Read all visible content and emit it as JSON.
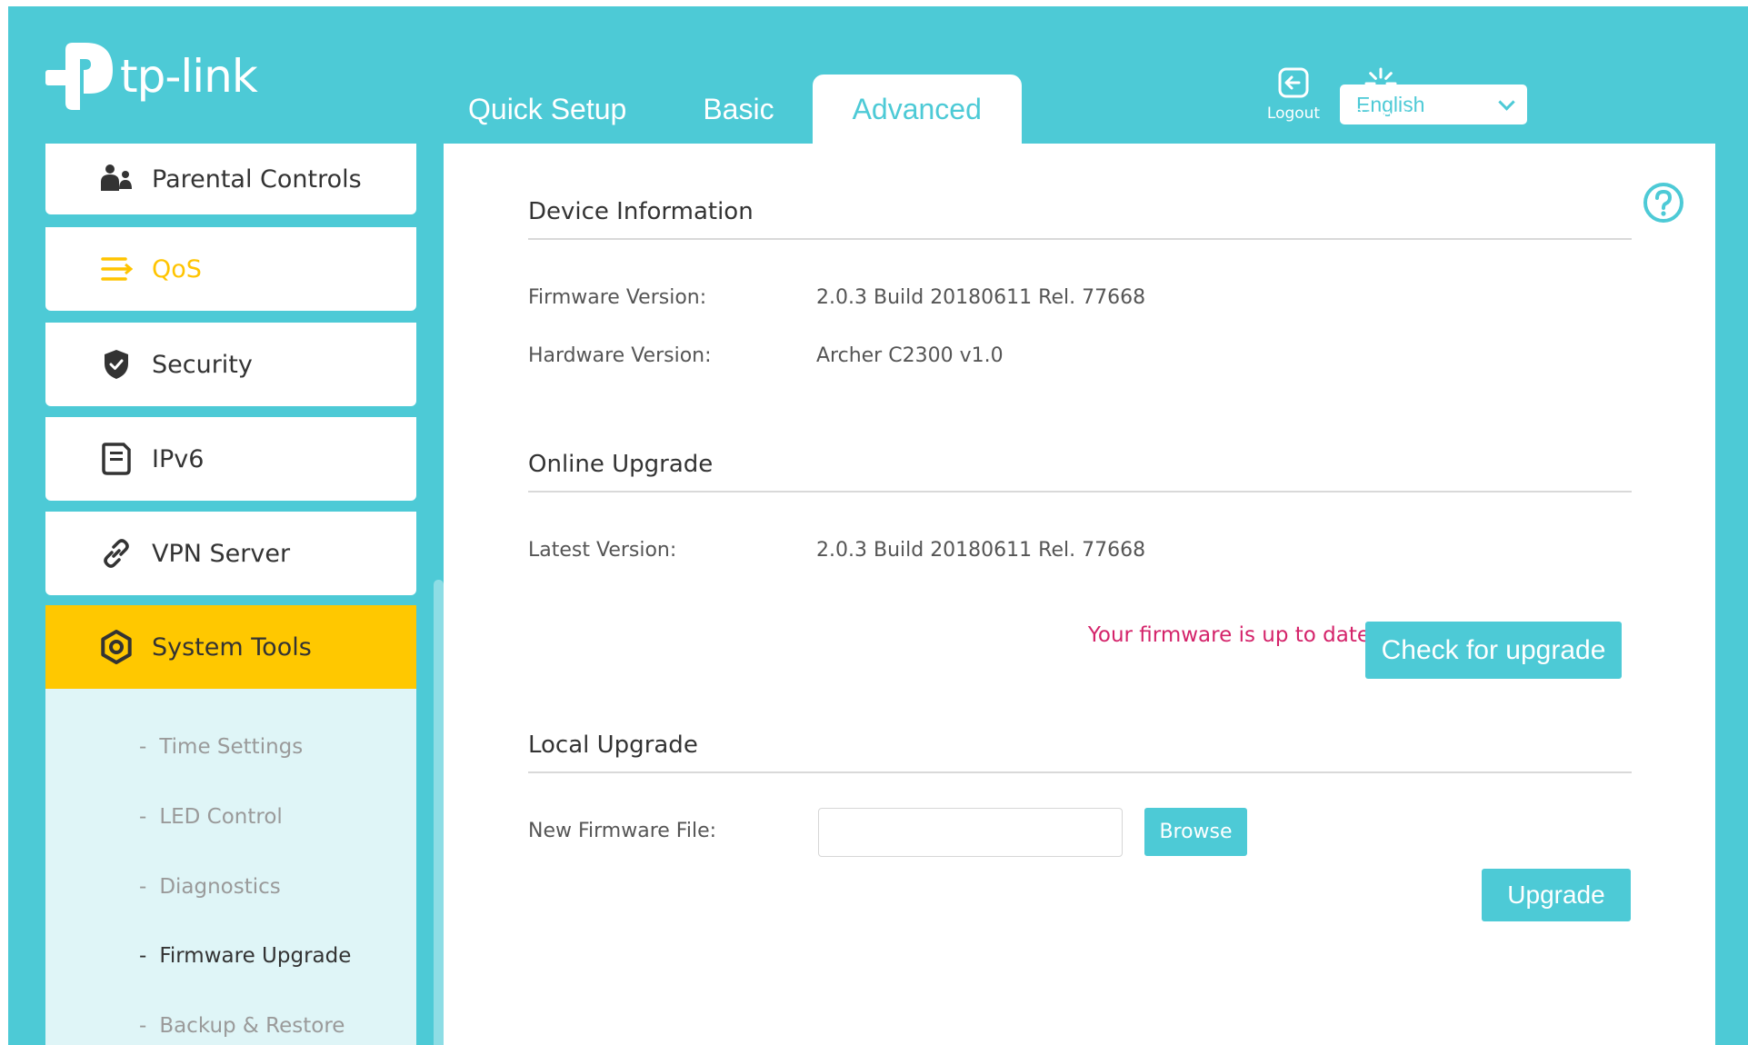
{
  "header": {
    "logo_text": "tp-link",
    "tabs": [
      {
        "label": "Quick Setup",
        "active": false
      },
      {
        "label": "Basic",
        "active": false
      },
      {
        "label": "Advanced",
        "active": true
      }
    ],
    "language": {
      "selected": "English"
    },
    "logout_label": "Logout",
    "reboot_label": "Reboot"
  },
  "sidebar": {
    "items": [
      {
        "label": "Parental Controls",
        "icon": "parental-controls-icon"
      },
      {
        "label": "QoS",
        "icon": "qos-icon"
      },
      {
        "label": "Security",
        "icon": "shield-icon"
      },
      {
        "label": "IPv6",
        "icon": "ipv6-icon"
      },
      {
        "label": "VPN Server",
        "icon": "link-icon"
      },
      {
        "label": "System Tools",
        "icon": "gear-icon",
        "active": true
      }
    ],
    "sub_items": [
      {
        "label": "Time Settings"
      },
      {
        "label": "LED Control"
      },
      {
        "label": "Diagnostics"
      },
      {
        "label": "Firmware Upgrade",
        "active": true
      },
      {
        "label": "Backup & Restore"
      }
    ],
    "dash": "-"
  },
  "main": {
    "device_info": {
      "title": "Device Information",
      "firmware_label": "Firmware Version:",
      "firmware_value": "2.0.3 Build 20180611 Rel. 77668",
      "hardware_label": "Hardware Version:",
      "hardware_value": "Archer C2300 v1.0"
    },
    "online_upgrade": {
      "title": "Online Upgrade",
      "latest_label": "Latest Version:",
      "latest_value": "2.0.3 Build 20180611 Rel. 77668",
      "status": "Your firmware is up to date",
      "check_button": "Check for upgrade"
    },
    "local_upgrade": {
      "title": "Local Upgrade",
      "file_label": "New Firmware File:",
      "file_value": "",
      "browse_button": "Browse",
      "upgrade_button": "Upgrade"
    }
  },
  "colors": {
    "accent": "#4dcad6",
    "highlight": "#ffc800",
    "status_red": "#d4236a"
  }
}
